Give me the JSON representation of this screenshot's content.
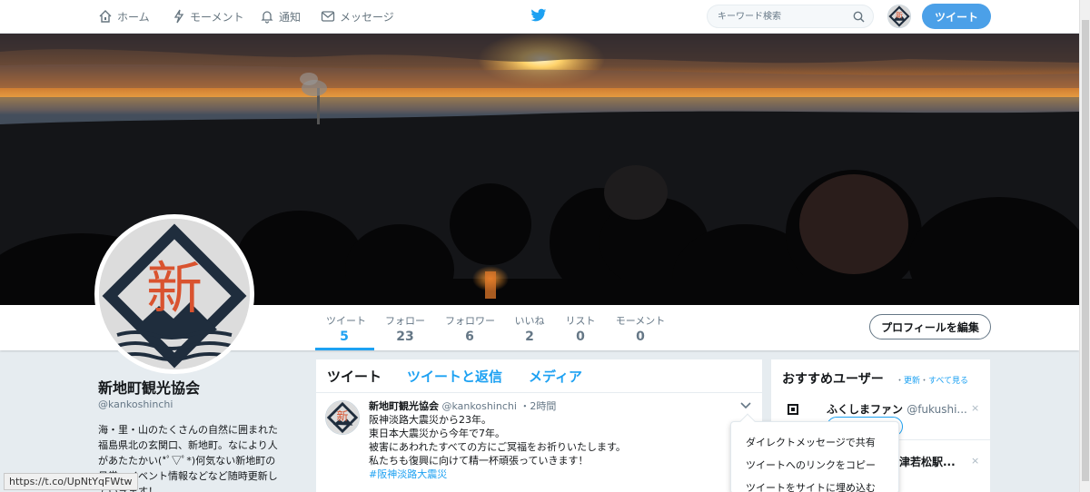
{
  "nav": {
    "home": "ホーム",
    "moments": "モーメント",
    "notifications": "通知",
    "messages": "メッセージ",
    "search_placeholder": "キーワード検索",
    "tweet_button": "ツイート"
  },
  "profile_nav": {
    "stats": [
      {
        "label": "ツイート",
        "value": "5"
      },
      {
        "label": "フォロー",
        "value": "23"
      },
      {
        "label": "フォロワー",
        "value": "6"
      },
      {
        "label": "いいね",
        "value": "2"
      },
      {
        "label": "リスト",
        "value": "0"
      },
      {
        "label": "モーメント",
        "value": "0"
      }
    ],
    "edit_button": "プロフィールを編集"
  },
  "profile": {
    "name": "新地町観光協会",
    "handle": "@kankoshinchi",
    "bio_lines": [
      "海・里・山のたくさんの自然に囲まれた",
      "福島県北の玄関口、新地町。なにより人",
      "があたたかい(*ﾟ▽ﾟ*)何気ない新地町の",
      "日常、イベント情報などなど随時更新し",
      "ていきます！"
    ]
  },
  "avatar_glyph": "新",
  "timeline": {
    "tabs": [
      "ツイート",
      "ツイートと返信",
      "メディア"
    ],
    "tweet": {
      "name": "新地町観光協会",
      "handle": "@kankoshinchi",
      "sep": "・",
      "time": "2時間",
      "lines": [
        "阪神淡路大震災から23年。",
        "東日本大震災から今年で7年。",
        "被害にあわれたすべての方にご冥福をお祈りいたします。",
        "私たちも復興に向けて精一杯頑張っていきます！"
      ],
      "hashtag": "#阪神淡路大震災"
    }
  },
  "dropdown": {
    "items": [
      "ダイレクトメッセージで共有",
      "ツイートへのリンクをコピー",
      "ツイートをサイトに埋め込む"
    ]
  },
  "recommendations": {
    "title": "おすすめユーザー",
    "sep": "・",
    "refresh": "更新",
    "view_all": "すべて見る",
    "users": [
      {
        "name": "ふくしまファン",
        "handle": "@fukushi..."
      },
      {
        "name": "津若松駅...",
        "handle": ""
      }
    ],
    "close_glyph": "×"
  },
  "status_url": "https://t.co/UpNtYqFWtw",
  "colors": {
    "accent": "#1da1f2",
    "tweet_button": "#4ba0e8",
    "avatar_red": "#d9532f",
    "avatar_navy": "#1f2d3d"
  }
}
